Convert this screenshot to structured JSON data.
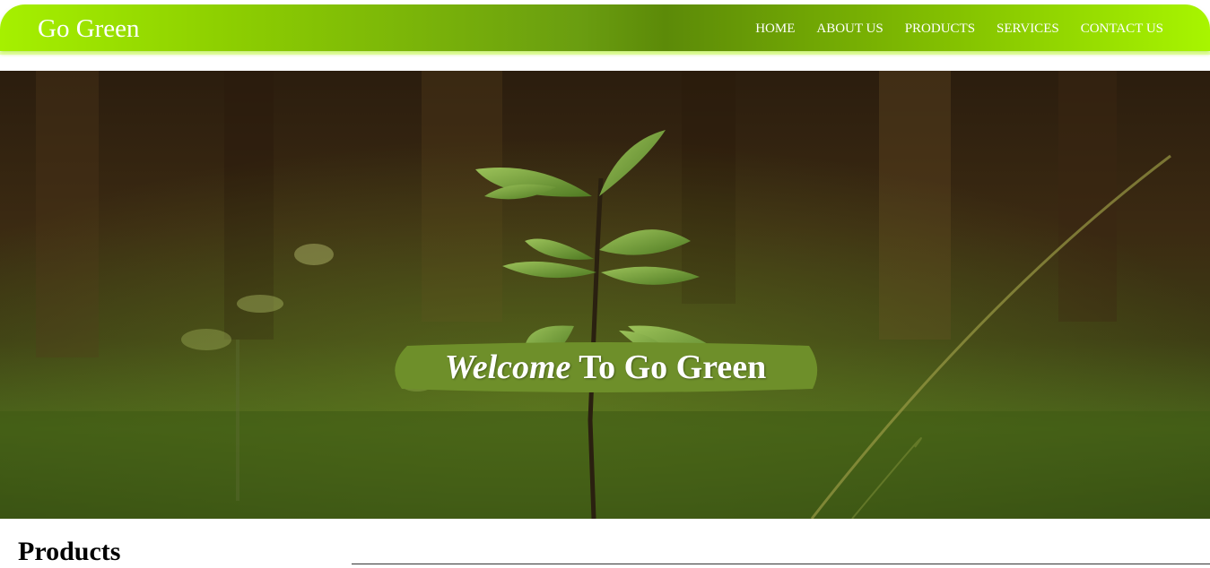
{
  "header": {
    "brand": "Go Green",
    "nav": [
      {
        "label": "HOME"
      },
      {
        "label": "ABOUT US"
      },
      {
        "label": "PRODUCTS"
      },
      {
        "label": "SERVICES"
      },
      {
        "label": "CONTACT US"
      }
    ]
  },
  "hero": {
    "welcome_word": "Welcome",
    "welcome_rest": " To Go Green",
    "image_description": "forest seedling photo"
  },
  "products": {
    "title": "Products"
  },
  "colors": {
    "nav_green_light": "#a6f000",
    "nav_green_dark": "#5c8a08",
    "banner_green": "#6e8f2a",
    "text_white": "#ffffff"
  }
}
